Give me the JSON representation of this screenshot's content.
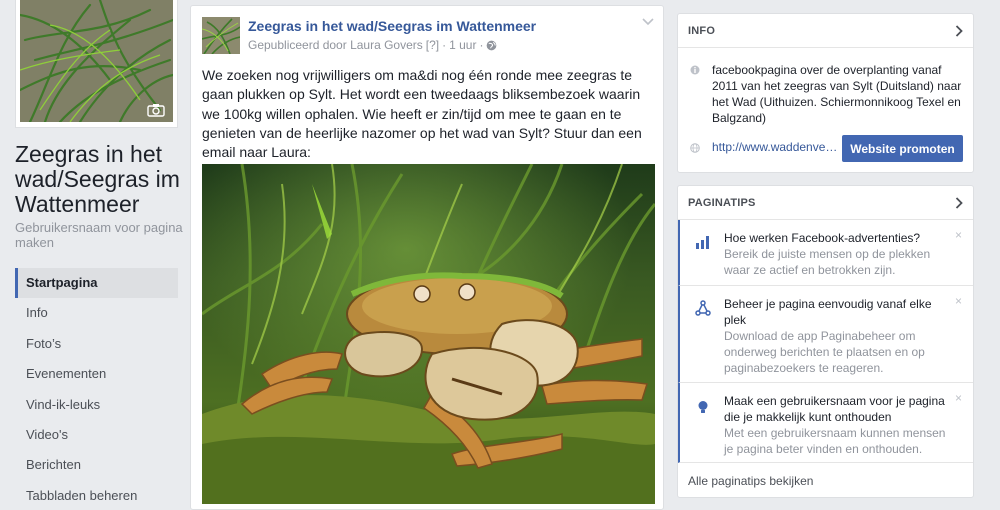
{
  "page": {
    "name": "Zeegras in het wad/Seegras im Wattenmeer",
    "username_prompt": "Gebruikersnaam voor pagina maken"
  },
  "nav": {
    "items": [
      {
        "label": "Startpagina",
        "active": true
      },
      {
        "label": "Info"
      },
      {
        "label": "Foto’s"
      },
      {
        "label": "Evenementen"
      },
      {
        "label": "Vind-ik-leuks"
      },
      {
        "label": "Video's"
      },
      {
        "label": "Berichten"
      },
      {
        "label": "Tabbladen beheren"
      }
    ]
  },
  "post": {
    "title": "Zeegras in het wad/Seegras im Wattenmeer",
    "published_by": "Gepubliceerd door Laura Govers",
    "help_marker": "[?]",
    "separator": "·",
    "time": "1 uur",
    "text": "We zoeken nog vrijwilligers om ma&di nog één ronde mee zeegras te gaan plukken op Sylt. Het wordt een tweedaags bliksembezoek waarin we 100kg willen ophalen. Wie heeft er zin/tijd om mee te gaan en te genieten van de heerlijke nazomer op het wad van Sylt? Stuur dan een email naar Laura:\nl.l.govers@rug.nl",
    "photo_icon": "crab-in-seagrass-photo"
  },
  "info_card": {
    "title": "INFO",
    "description": "facebookpagina over de overplanting vanaf 2011 van het zeegras van Sylt (Duitsland) naar het Wad (Uithuizen. Schiermonnikoog Texel en Balgzand)",
    "link": "http://www.waddenve…",
    "promote_button": "Website promoten"
  },
  "tips_card": {
    "title": "PAGINATIPS",
    "tips": [
      {
        "title": "Hoe werken Facebook-advertenties?",
        "desc": "Bereik de juiste mensen op de plekken waar ze actief en betrokken zijn.",
        "icon": "bar-chart-icon"
      },
      {
        "title": "Beheer je pagina eenvoudig vanaf elke plek",
        "desc": "Download de app Paginabeheer om onderweg berichten te plaatsen en op paginabezoekers te reageren.",
        "icon": "network-icon"
      },
      {
        "title": "Maak een gebruikersnaam voor je pagina die je makkelijk kunt onthouden",
        "desc": "Met een gebruikersnaam kunnen mensen je pagina beter vinden en onthouden.",
        "icon": "lightbulb-icon"
      }
    ],
    "close_glyph": "×",
    "see_all": "Alle paginatips bekijken"
  },
  "colors": {
    "accent": "#4267b2",
    "link": "#365899",
    "background": "#e9ebee"
  }
}
